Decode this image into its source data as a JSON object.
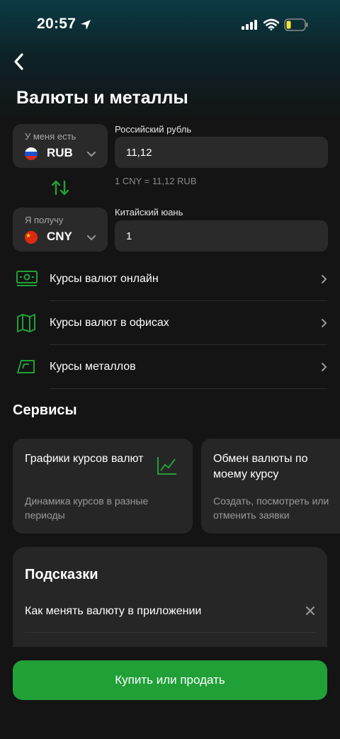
{
  "status_bar": {
    "time": "20:57"
  },
  "page": {
    "title": "Валюты и металлы"
  },
  "exchange": {
    "from": {
      "caption": "У меня есть",
      "code": "RUB",
      "flag": "russia-flag",
      "field_label": "Российский рубль",
      "amount": "11,12"
    },
    "rate_text": "1 CNY = 11,12 RUB",
    "to": {
      "caption": "Я получу",
      "code": "CNY",
      "flag": "china-flag",
      "field_label": "Китайский юань",
      "amount": "1"
    }
  },
  "menu": [
    {
      "label": "Курсы валют онлайн",
      "icon": "banknote-icon"
    },
    {
      "label": "Курсы валют в офисах",
      "icon": "map-icon"
    },
    {
      "label": "Курсы металлов",
      "icon": "gold-bar-icon"
    }
  ],
  "services": {
    "title": "Сервисы",
    "cards": [
      {
        "title": "Графики курсов валют",
        "description": "Динамика курсов в разные периоды",
        "icon": "chart-icon"
      },
      {
        "title": "Обмен валюты по моему курсу",
        "description": "Создать, посмотреть или отменить заявки"
      }
    ]
  },
  "hints": {
    "title": "Подсказки",
    "items": [
      {
        "label": "Как менять валюту в приложении"
      }
    ]
  },
  "primary_action": {
    "label": "Купить или продать"
  },
  "colors": {
    "accent": "#21a038",
    "background": "#141414",
    "card": "#262626",
    "field": "#2a2a2a"
  }
}
